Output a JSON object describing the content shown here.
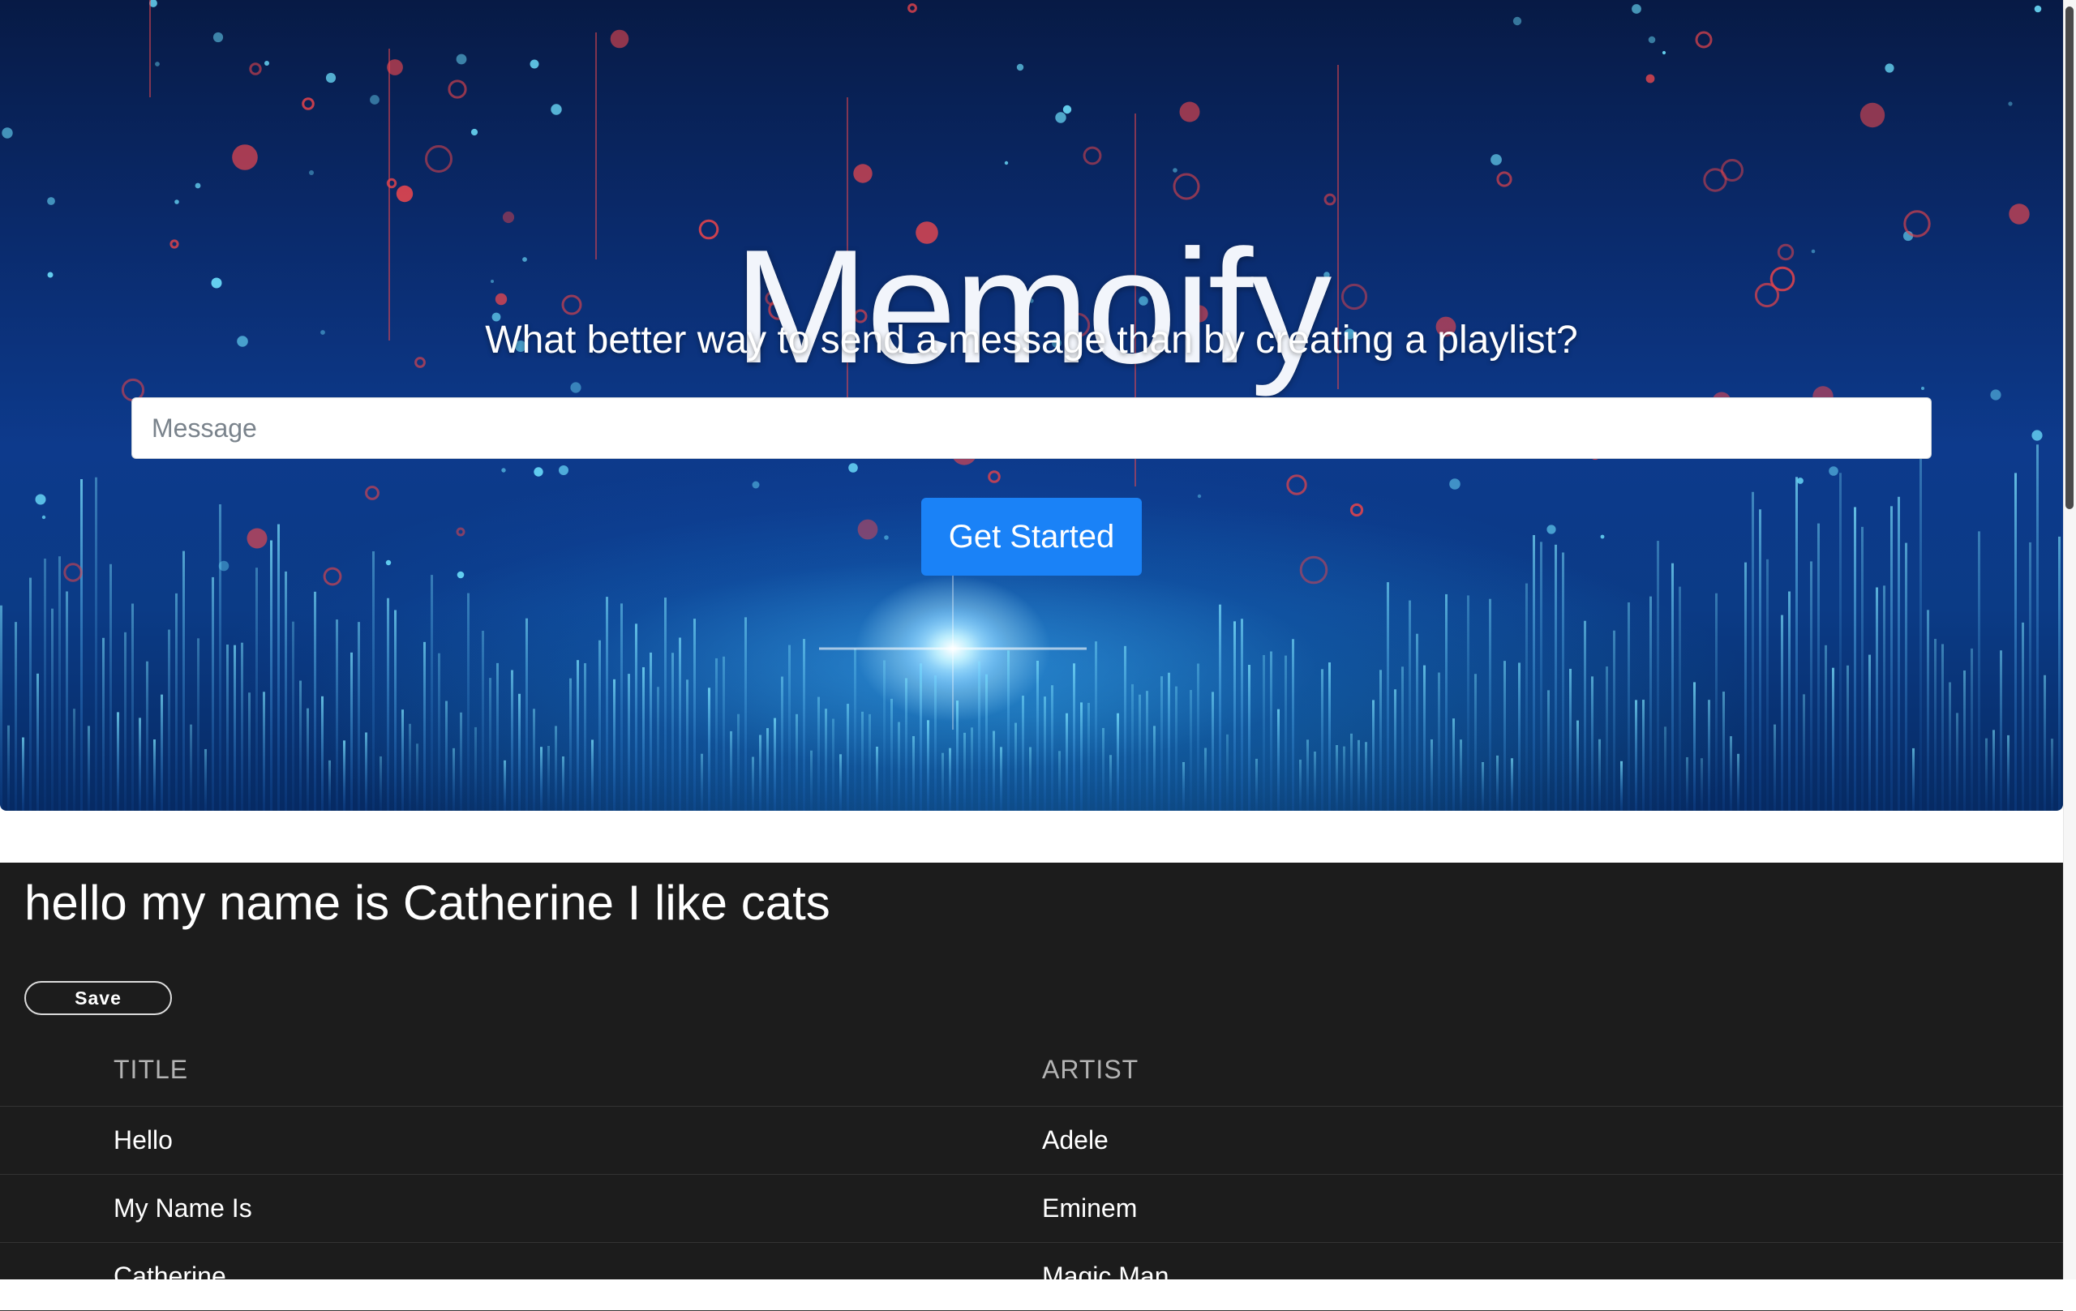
{
  "hero": {
    "title": "Memoify",
    "subtitle": "What better way to send a message than by creating a playlist?",
    "message_placeholder": "Message",
    "message_value": "",
    "cta_label": "Get Started"
  },
  "playlist": {
    "message": "hello my name is Catherine I like cats",
    "save_label": "Save",
    "columns": {
      "title": "TITLE",
      "artist": "ARTIST"
    },
    "tracks": [
      {
        "title": "Hello",
        "artist": "Adele"
      },
      {
        "title": "My Name Is",
        "artist": "Eminem"
      },
      {
        "title": "Catherine",
        "artist": "Magic Man"
      }
    ]
  },
  "colors": {
    "accent": "#1a82f7",
    "playlist_bg": "#1c1c1c",
    "hero_bg": "#0a2a6b"
  }
}
